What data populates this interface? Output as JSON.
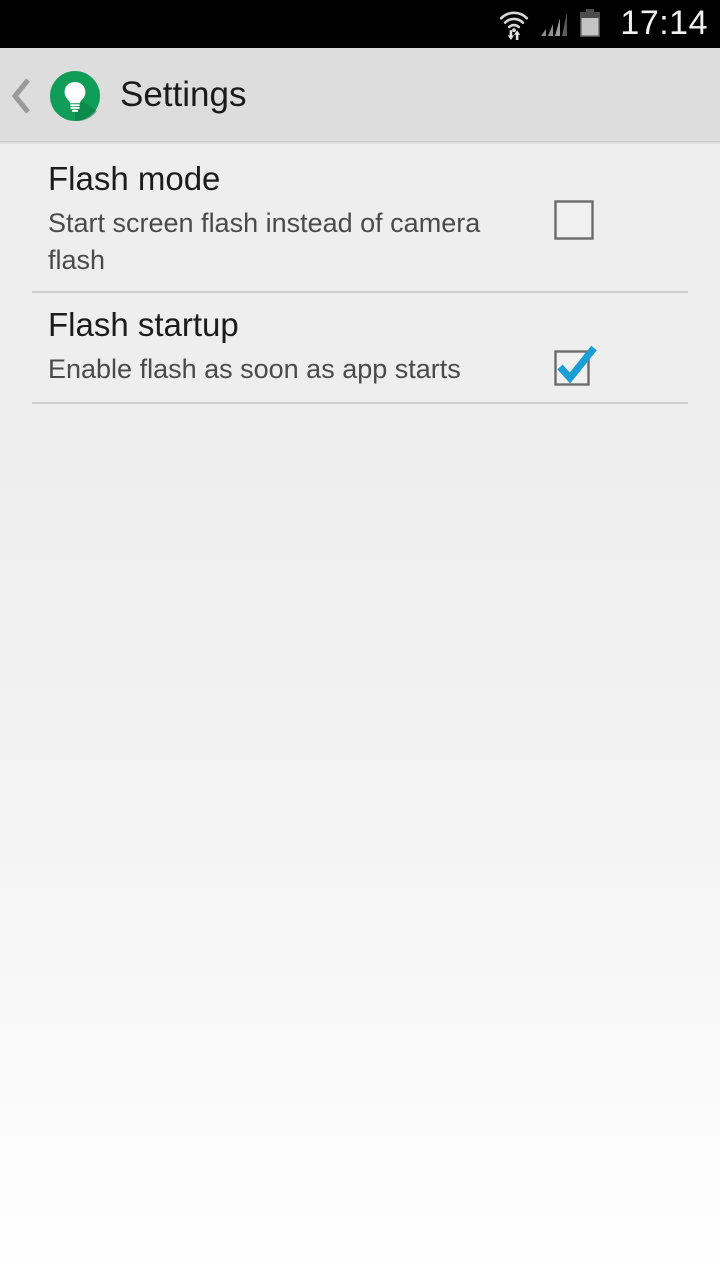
{
  "status_bar": {
    "time": "17:14",
    "icons": [
      {
        "name": "wifi-icon",
        "label": "wifi-with-activity"
      },
      {
        "name": "signal-icon",
        "label": "cellular-signal"
      },
      {
        "name": "battery-icon",
        "label": "battery"
      }
    ],
    "background": "#000000",
    "text_color": "#f2f2f2"
  },
  "action_bar": {
    "back_icon": "chevron-left-icon",
    "app_icon": "flashlight-bulb-icon",
    "app_icon_color": "#0f9d58",
    "title": "Settings",
    "background": "#dddddd"
  },
  "settings": {
    "items": [
      {
        "title": "Flash mode",
        "summary": "Start screen flash instead of camera flash",
        "checked": false,
        "widget": "checkbox"
      },
      {
        "title": "Flash startup",
        "summary": "Enable flash as soon as app starts",
        "checked": true,
        "widget": "checkbox"
      }
    ],
    "checkbox_checked_color": "#1a9fd4",
    "checkbox_border_color": "#6b6b6b",
    "divider_color": "#cdcdcd"
  }
}
